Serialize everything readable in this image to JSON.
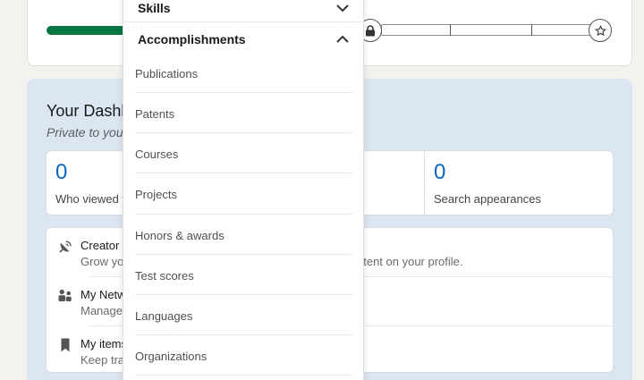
{
  "profile_strength": {
    "progress_level": 0.2
  },
  "dashboard": {
    "title": "Your Dashb",
    "subtitle": "Private to you",
    "stats": [
      {
        "value": "0",
        "label": "Who viewed y"
      },
      {
        "value": "0",
        "label": "Search appearances"
      }
    ],
    "rows": [
      {
        "icon": "satellite-dish-icon",
        "title": "Creator m",
        "desc": "Grow you",
        "desc_right": "ntent on your profile."
      },
      {
        "icon": "people-icon",
        "title": "My Netw",
        "desc": "Manage"
      },
      {
        "icon": "bookmark-icon",
        "title": "My items",
        "desc": "Keep trac"
      }
    ]
  },
  "menu": {
    "skills_label": "Skills",
    "accomplishments_label": "Accomplishments",
    "items": [
      "Publications",
      "Patents",
      "Courses",
      "Projects",
      "Honors & awards",
      "Test scores",
      "Languages",
      "Organizations"
    ]
  },
  "colors": {
    "accent_blue": "#0a66c2",
    "progress_green": "#057642",
    "dashboard_bg": "#dce6f1"
  }
}
